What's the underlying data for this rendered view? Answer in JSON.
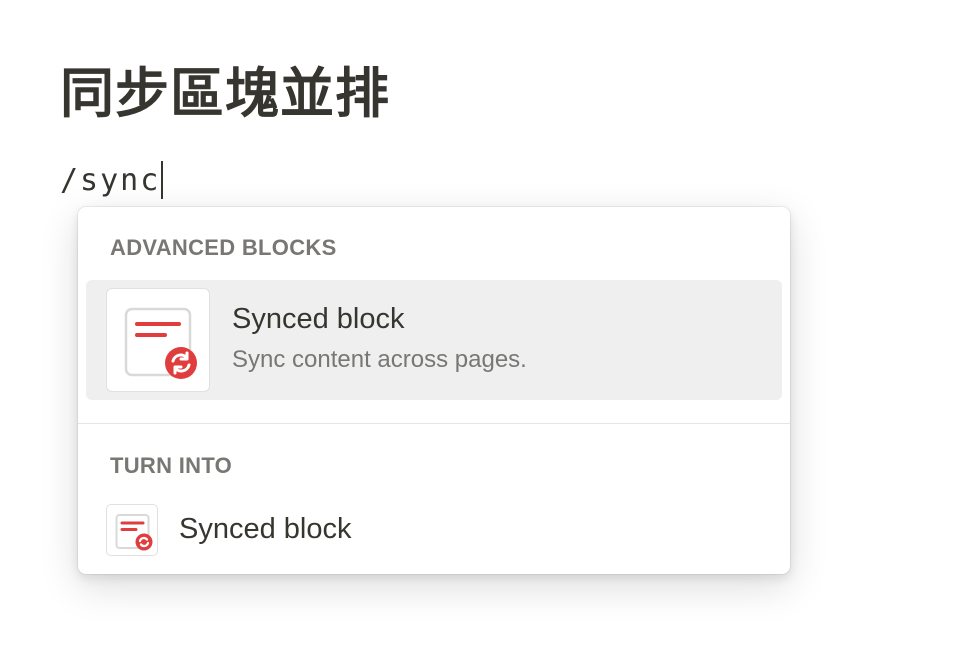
{
  "page": {
    "title": "同步區塊並排",
    "command_text": "/sync"
  },
  "menu": {
    "sections": [
      {
        "header": "ADVANCED BLOCKS",
        "items": [
          {
            "title": "Synced block",
            "description": "Sync content across pages.",
            "icon": "synced-block-icon",
            "selected": true
          }
        ]
      },
      {
        "header": "TURN INTO",
        "items": [
          {
            "title": "Synced block",
            "icon": "synced-block-icon",
            "selected": false
          }
        ]
      }
    ]
  },
  "colors": {
    "text": "#37352f",
    "muted": "#787774",
    "selected_bg": "#efefef",
    "icon_accent": "#e03e3e"
  }
}
